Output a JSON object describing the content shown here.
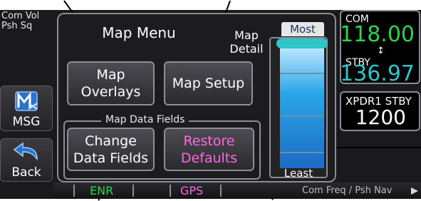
{
  "knob_label": [
    "Com Vol",
    "Psh Sq"
  ],
  "left_buttons": {
    "msg": "MSG",
    "back": "Back"
  },
  "icons": {
    "msg": "mail-envelope-icon",
    "back": "back-arrow-icon",
    "nav": "triangle-right-icon"
  },
  "dialog": {
    "title": "Map Menu",
    "buttons": {
      "map_overlays": [
        "Map",
        "Overlays"
      ],
      "map_setup": "Map Setup",
      "change_data_fields": [
        "Change",
        "Data Fields"
      ],
      "restore_defaults": [
        "Restore",
        "Defaults"
      ]
    },
    "group_label": "Map Data Fields"
  },
  "map_detail": {
    "label": [
      "Map",
      "Detail"
    ],
    "top": "Most",
    "bottom": "Least",
    "level": 1.0
  },
  "radio": {
    "com_label": "COM",
    "com_value": "118.00",
    "com_swap": "↕",
    "stby_label": "STBY",
    "stby_value": "136.97",
    "xpdr_label": "XPDR1 STBY",
    "xpdr_code": "1200"
  },
  "bottom_bar": {
    "enr": "ENR",
    "gps": "GPS",
    "right_hint": "Com Freq / Psh Nav"
  },
  "colors": {
    "cyan": "#2ec5c9",
    "green": "#27d44a",
    "magenta": "#ff66e6",
    "background": "#1a1a1c"
  }
}
